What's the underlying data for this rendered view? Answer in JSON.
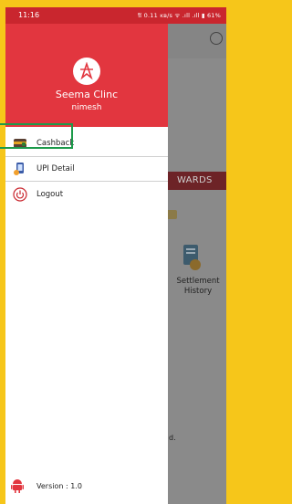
{
  "status_bar": {
    "time": "11:16",
    "indicators": "𝔄 0.11 ᴋʙ/s ᯤ .ıll .ıll ▮ 61%"
  },
  "background": {
    "rewards_label": "WARDS",
    "settlement_label_line1": "Settlement",
    "settlement_label_line2": "History",
    "fragment_text": "d."
  },
  "drawer": {
    "clinic_name": "Seema Clinc",
    "user_name": "nimesh",
    "items": [
      {
        "label": "Cashback",
        "icon": "wallet-icon"
      },
      {
        "label": "UPI Detail",
        "icon": "upi-icon"
      },
      {
        "label": "Logout",
        "icon": "power-icon"
      }
    ],
    "version": "Version : 1.0"
  },
  "colors": {
    "brand_red": "#e2363f",
    "highlight_green": "#1c9a4a",
    "frame_yellow": "#f6c61a"
  }
}
